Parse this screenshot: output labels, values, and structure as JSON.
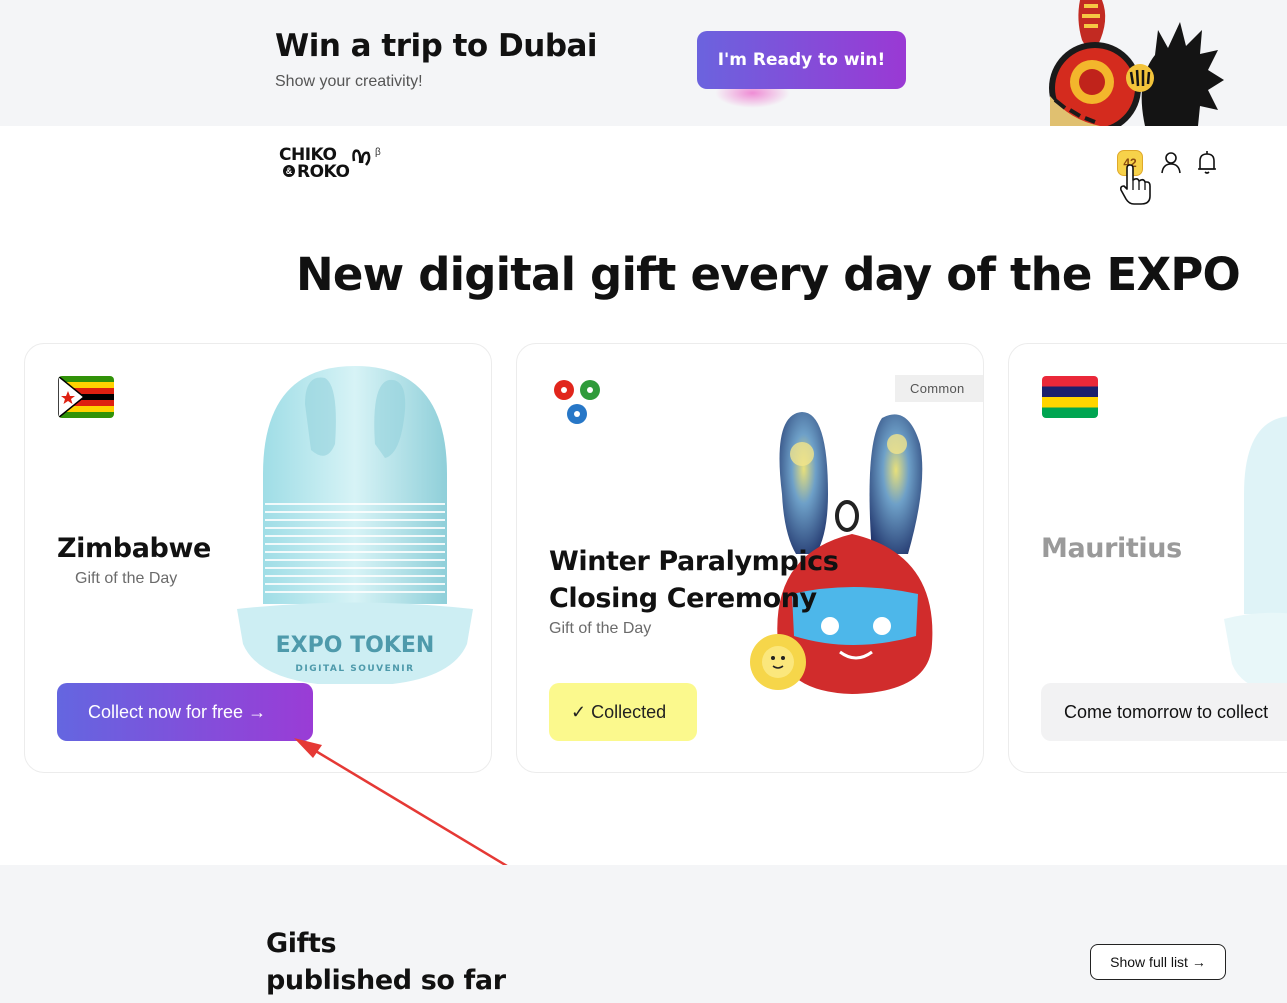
{
  "promo": {
    "title": "Win a trip to Dubai",
    "subtitle": "Show your creativity!",
    "cta_label": "I'm Ready to win!",
    "cta_gradient": [
      "#6b63de",
      "#9a39d4"
    ]
  },
  "header": {
    "logo_line1": "CHIKO",
    "logo_line2": "ROKO",
    "logo_amp": "&",
    "logo_beta": "β",
    "points_badge": "42",
    "icons": [
      "points-badge",
      "user-icon",
      "bell-icon"
    ]
  },
  "headline": "New digital gift every day of the EXPO",
  "cards": [
    {
      "country": "Zimbabwe",
      "subtitle": "Gift of the Day",
      "flag_icon": "zimbabwe-flag-icon",
      "product_icon": "expo-token-icon",
      "product_text": "EXPO TOKEN",
      "product_subtext": "DIGITAL SOUVENIR",
      "button_label": "Collect now for free →",
      "button_state": "collect"
    },
    {
      "country": "Winter Paralympics Closing Ceremony",
      "subtitle": "Gift of the Day",
      "flag_icon": "paralympics-logo-icon",
      "rarity": "Common",
      "product_icon": "fireworks-bunny-icon",
      "button_label": "✓ Collected",
      "button_state": "collected"
    },
    {
      "country": "Mauritius",
      "subtitle": "",
      "flag_icon": "mauritius-flag-icon",
      "product_icon": "expo-token-icon",
      "button_label": "Come tomorrow to collect",
      "button_state": "locked"
    }
  ],
  "gifts_section": {
    "title_line1": "Gifts",
    "title_line2": "published so far",
    "show_full_label": "Show full list →"
  },
  "colors": {
    "accent_gradient_start": "#6466e0",
    "accent_gradient_end": "#9a3cd6",
    "collected_yellow": "#fbf98d",
    "points_yellow": "#f7d24a",
    "annotation_red": "#e53935"
  }
}
